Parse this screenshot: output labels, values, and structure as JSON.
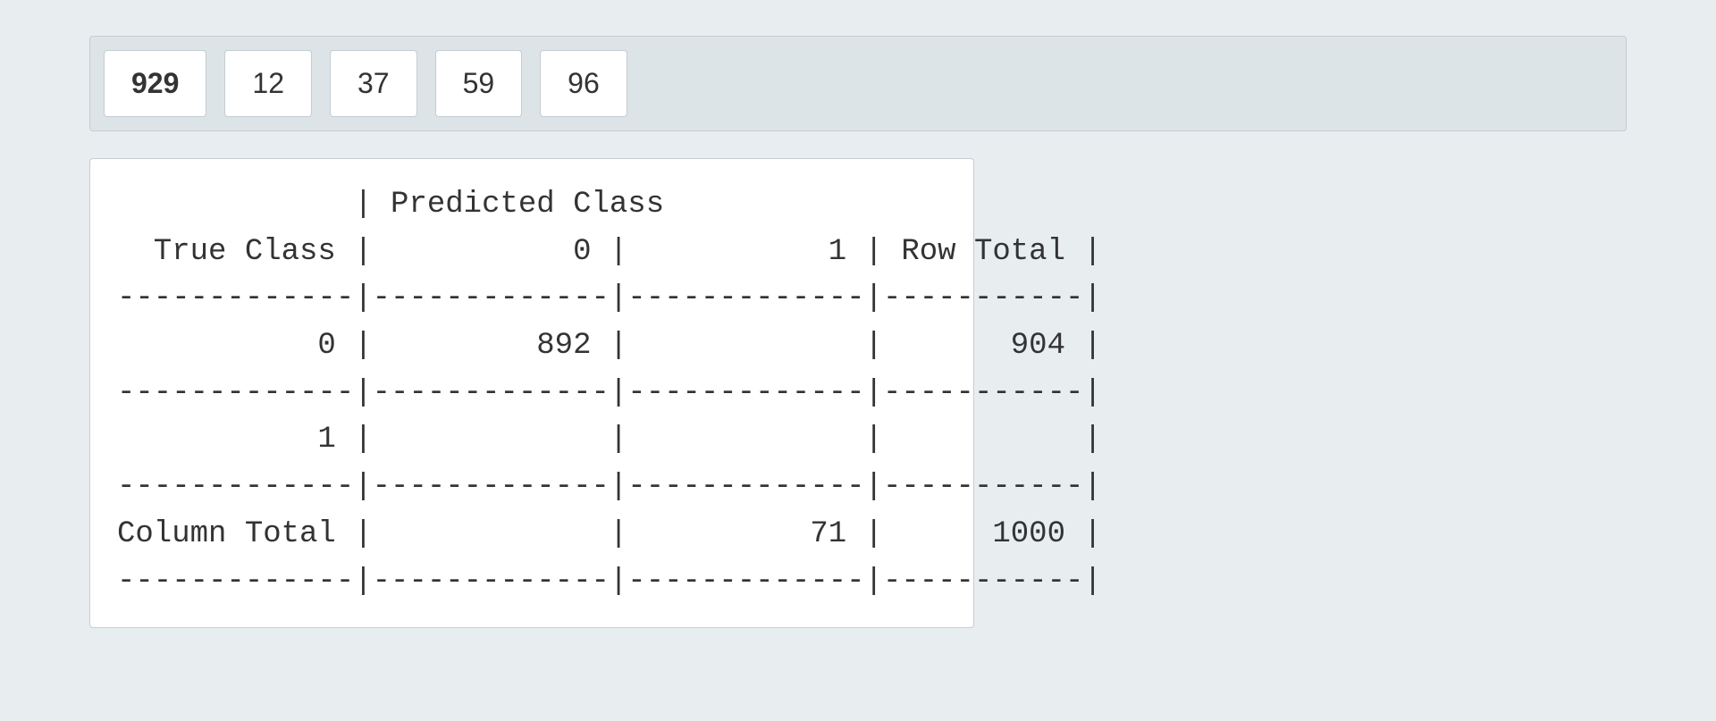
{
  "answers": {
    "box1": "929",
    "box2": "12",
    "box3": "37",
    "box4": "59",
    "box5": "96"
  },
  "confusion_table": {
    "header_line": "             | Predicted Class",
    "cols_line": "  True Class |           0 |           1 | Row Total |",
    "sep": "-------------|-------------|-------------|-----------|",
    "row0": "           0 |         892 |             |       904 |",
    "row1": "           1 |             |             |           |",
    "row_total": "Column Total |             |          71 |      1000 |"
  }
}
